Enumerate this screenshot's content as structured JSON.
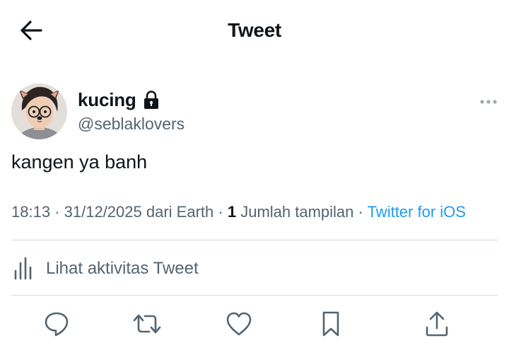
{
  "header": {
    "title": "Tweet",
    "back_icon": "arrow-left-icon"
  },
  "tweet": {
    "author": {
      "display_name": "kucing",
      "handle": "@seblaklovers",
      "protected_icon": "lock-icon"
    },
    "text": "kangen ya banh",
    "meta": {
      "time": "18:13",
      "date": "31/12/2025",
      "location": "dari Earth",
      "views_count": "1",
      "views_label": "Jumlah tampilan",
      "source": "Twitter for iOS",
      "separator": "·"
    },
    "activity_label": "Lihat aktivitas Tweet"
  },
  "actions": [
    {
      "name": "reply",
      "icon": "reply-icon"
    },
    {
      "name": "retweet",
      "icon": "retweet-icon"
    },
    {
      "name": "like",
      "icon": "heart-icon"
    },
    {
      "name": "bookmark",
      "icon": "bookmark-icon"
    },
    {
      "name": "share",
      "icon": "share-icon"
    }
  ],
  "colors": {
    "text_primary": "#0f1419",
    "text_secondary": "#536471",
    "link": "#1d9bf0",
    "divider": "#cfd9de"
  }
}
